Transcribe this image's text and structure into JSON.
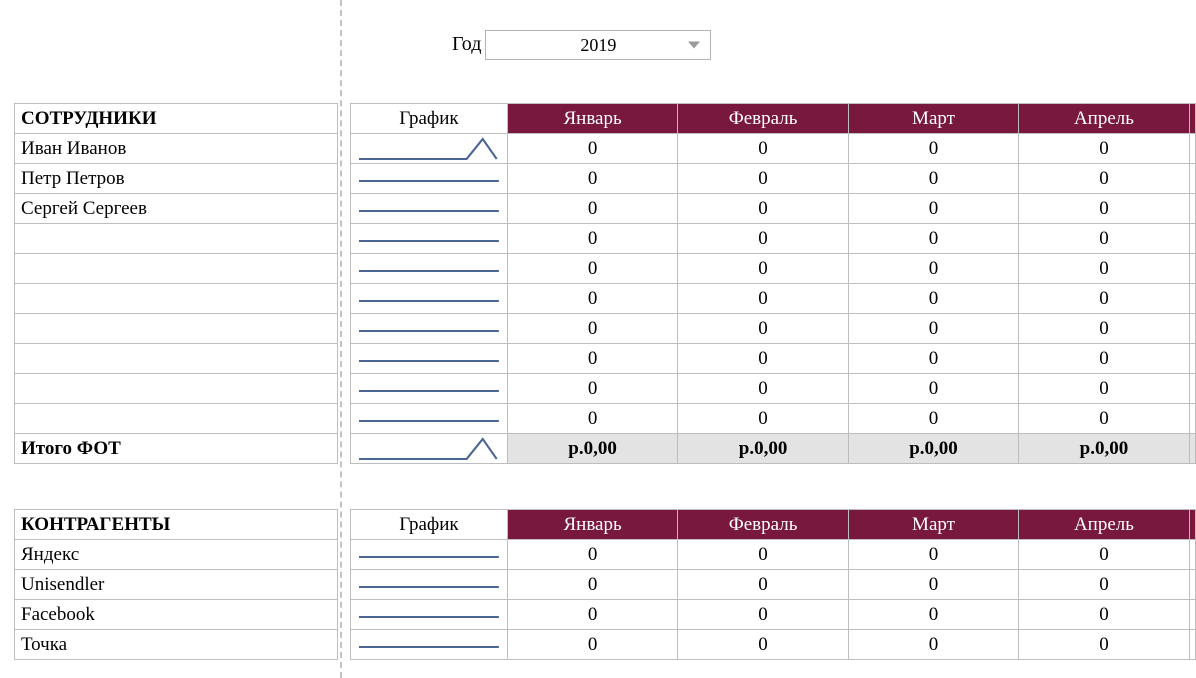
{
  "year": {
    "label": "Год",
    "value": "2019"
  },
  "columns": {
    "graph": "График",
    "months": [
      "Январь",
      "Февраль",
      "Март",
      "Апрель"
    ]
  },
  "employees": {
    "header": "СОТРУДНИКИ",
    "rows": [
      {
        "name": "Иван Иванов",
        "spark": "spike",
        "values": [
          "0",
          "0",
          "0",
          "0"
        ]
      },
      {
        "name": "Петр Петров",
        "spark": "flat",
        "values": [
          "0",
          "0",
          "0",
          "0"
        ]
      },
      {
        "name": "Сергей Сергеев",
        "spark": "flat",
        "values": [
          "0",
          "0",
          "0",
          "0"
        ]
      },
      {
        "name": "",
        "spark": "flat",
        "values": [
          "0",
          "0",
          "0",
          "0"
        ]
      },
      {
        "name": "",
        "spark": "flat",
        "values": [
          "0",
          "0",
          "0",
          "0"
        ]
      },
      {
        "name": "",
        "spark": "flat",
        "values": [
          "0",
          "0",
          "0",
          "0"
        ]
      },
      {
        "name": "",
        "spark": "flat",
        "values": [
          "0",
          "0",
          "0",
          "0"
        ]
      },
      {
        "name": "",
        "spark": "flat",
        "values": [
          "0",
          "0",
          "0",
          "0"
        ]
      },
      {
        "name": "",
        "spark": "flat",
        "values": [
          "0",
          "0",
          "0",
          "0"
        ]
      },
      {
        "name": "",
        "spark": "flat",
        "values": [
          "0",
          "0",
          "0",
          "0"
        ]
      }
    ],
    "total": {
      "label": "Итого ФОТ",
      "spark": "spike",
      "values": [
        "р.0,00",
        "р.0,00",
        "р.0,00",
        "р.0,00"
      ]
    }
  },
  "counterparties": {
    "header": "КОНТРАГЕНТЫ",
    "rows": [
      {
        "name": "Яндекс",
        "spark": "flat",
        "values": [
          "0",
          "0",
          "0",
          "0"
        ]
      },
      {
        "name": "Unisendler",
        "spark": "flat",
        "values": [
          "0",
          "0",
          "0",
          "0"
        ]
      },
      {
        "name": "Facebook",
        "spark": "flat",
        "values": [
          "0",
          "0",
          "0",
          "0"
        ]
      },
      {
        "name": "Точка",
        "spark": "flat",
        "values": [
          "0",
          "0",
          "0",
          "0"
        ]
      }
    ]
  }
}
